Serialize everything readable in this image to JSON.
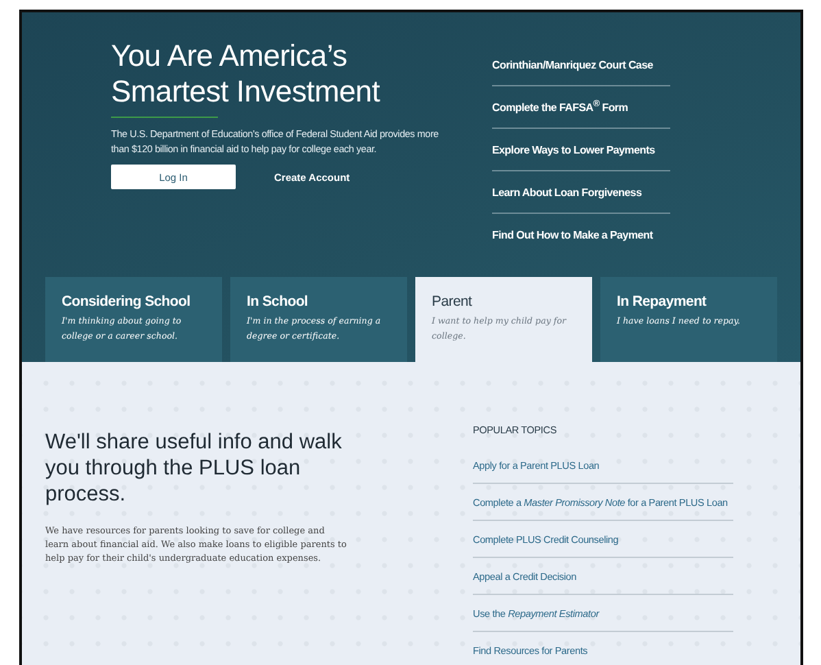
{
  "hero": {
    "title": "You Are America’s Smartest Investment",
    "description": "The U.S. Department of Education's office of Federal Student Aid provides more than $120 billion in financial aid to help pay for college each year.",
    "buttons": [
      {
        "label": "Log In",
        "kind": "primary"
      },
      {
        "label": "Create Account",
        "kind": "link"
      }
    ],
    "links": [
      "Corinthian/Manriquez Court Case",
      "Complete the FAFSA$^{®}$ Form",
      "Explore Ways to Lower Payments",
      "Learn About Loan Forgiveness",
      "Find Out How to Make a Payment"
    ]
  },
  "tabs": [
    {
      "label": "Considering School",
      "description": "I'm thinking about going to college or a career school.",
      "selected": false
    },
    {
      "label": "In School",
      "description": "I'm in the process of earning a degree or certificate.",
      "selected": false
    },
    {
      "label": "Parent",
      "description": "I want to help my child pay for college.",
      "selected": true
    },
    {
      "label": "In Repayment",
      "description": "I have loans I need to repay.",
      "selected": false
    }
  ],
  "content": {
    "heading": "We'll share useful info and walk you through the PLUS loan process.",
    "body": "We have resources for parents looking to save for college and learn about financial aid. We also make loans to eligible parents to help pay for their child's undergraduate education expenses.",
    "topics_title": "POPULAR TOPICS",
    "topics": [
      "Apply for a Parent PLUS Loan",
      "Complete a *Master Promissory Note* for a Parent PLUS Loan",
      "Complete PLUS Credit Counseling",
      "Appeal a Credit Decision",
      "Use the *Repayment Estimator*",
      "Find Resources for Parents"
    ]
  }
}
